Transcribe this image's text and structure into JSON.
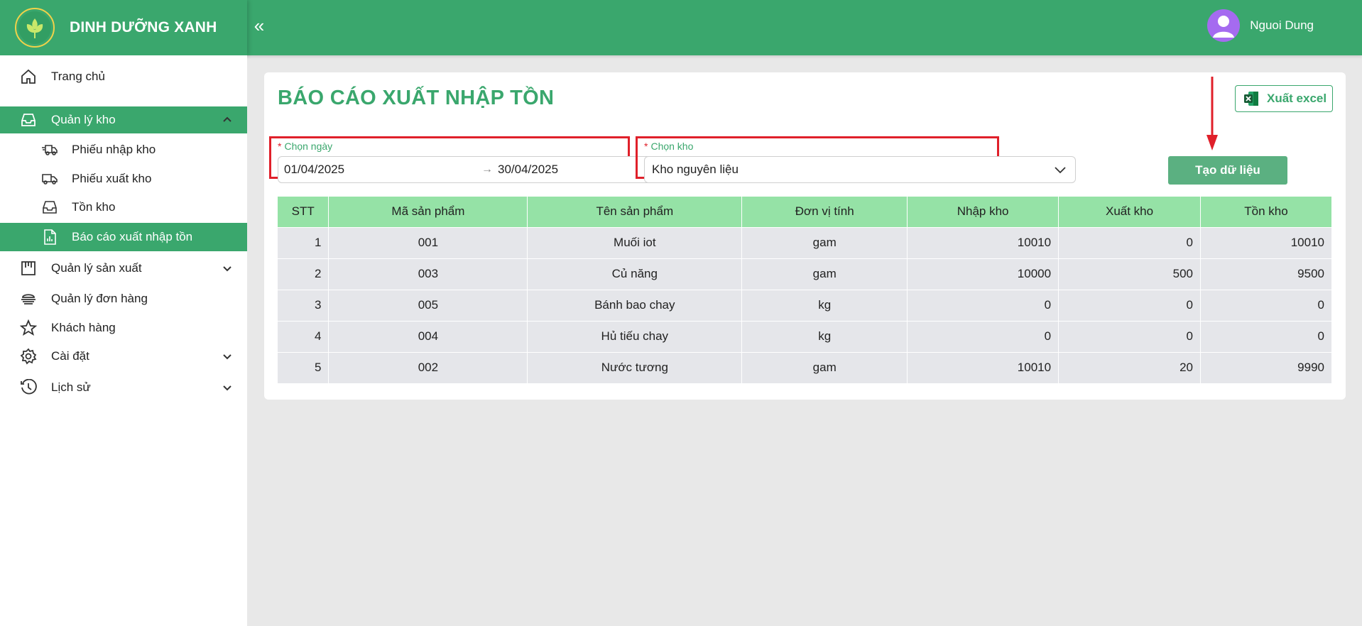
{
  "brand": {
    "name": "DINH DƯỠNG XANH",
    "collapse_icon": "«"
  },
  "user": {
    "name": "Nguoi Dung"
  },
  "sidebar": {
    "items": [
      {
        "label": "Trang chủ",
        "icon": "home-icon"
      },
      {
        "label": "Quản lý kho",
        "icon": "inbox-icon",
        "expanded": true
      },
      {
        "label": "Phiếu nhập kho",
        "icon": "truck-fast-icon"
      },
      {
        "label": "Phiếu xuất kho",
        "icon": "truck-icon"
      },
      {
        "label": "Tồn kho",
        "icon": "inbox-icon"
      },
      {
        "label": "Báo cáo xuất nhập tồn",
        "icon": "report-icon",
        "active": true
      },
      {
        "label": "Quản lý sản xuất",
        "icon": "factory-icon"
      },
      {
        "label": "Quản lý đơn hàng",
        "icon": "orders-icon"
      },
      {
        "label": "Khách hàng",
        "icon": "star-icon"
      },
      {
        "label": "Cài đặt",
        "icon": "gear-icon"
      },
      {
        "label": "Lịch sử",
        "icon": "history-icon"
      }
    ]
  },
  "main": {
    "title": "BÁO CÁO XUẤT NHẬP TỒN",
    "export_label": "Xuất excel",
    "date_field": {
      "required_mark": "*",
      "label": "Chọn ngày",
      "start": "01/04/2025",
      "end": "30/04/2025",
      "separator": "→"
    },
    "store_field": {
      "required_mark": "*",
      "label": "Chọn kho",
      "value": "Kho nguyên liệu"
    },
    "create_label": "Tạo dữ liệu",
    "table": {
      "headers": [
        "STT",
        "Mã sản phẩm",
        "Tên sản phẩm",
        "Đơn vị tính",
        "Nhập kho",
        "Xuất kho",
        "Tồn kho"
      ],
      "rows": [
        [
          "1",
          "001",
          "Muối iot",
          "gam",
          "10010",
          "0",
          "10010"
        ],
        [
          "2",
          "003",
          "Củ năng",
          "gam",
          "10000",
          "500",
          "9500"
        ],
        [
          "3",
          "005",
          "Bánh bao chay",
          "kg",
          "0",
          "0",
          "0"
        ],
        [
          "4",
          "004",
          "Hủ tiếu chay",
          "kg",
          "0",
          "0",
          "0"
        ],
        [
          "5",
          "002",
          "Nước tương",
          "gam",
          "10010",
          "20",
          "9990"
        ]
      ]
    }
  },
  "colors": {
    "primary": "#3aa76d",
    "header_row": "#95e2a6",
    "highlight": "#e0202a",
    "avatar": "#a56bf0"
  }
}
